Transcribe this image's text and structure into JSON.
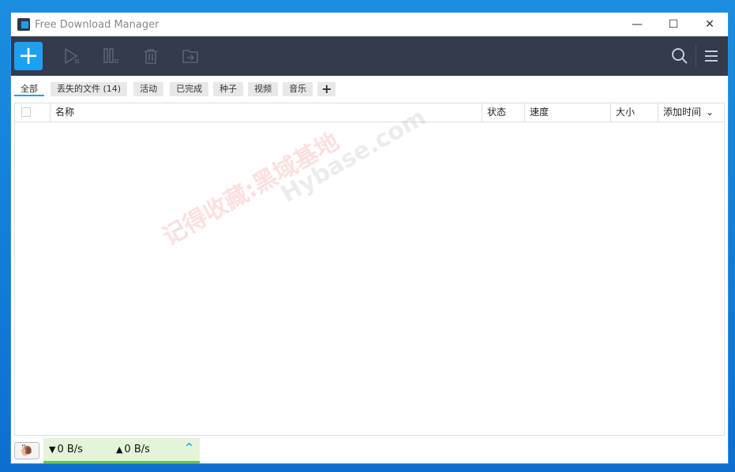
{
  "window": {
    "title": "Free Download Manager",
    "minimize": "—",
    "maximize": "☐",
    "close": "✕"
  },
  "toolbar": {
    "add": "+",
    "icons": [
      "play-icon",
      "pause-icon",
      "trash-icon",
      "move-folder-icon",
      "search-icon",
      "menu-icon"
    ]
  },
  "tabs": [
    {
      "label": "全部",
      "active": true
    },
    {
      "label": "丢失的文件 (14)"
    },
    {
      "label": "活动"
    },
    {
      "label": "已完成"
    },
    {
      "label": "种子"
    },
    {
      "label": "视频"
    },
    {
      "label": "音乐"
    },
    {
      "label": "+"
    }
  ],
  "table": {
    "columns": [
      "名称",
      "状态",
      "速度",
      "大小",
      "添加时间"
    ],
    "sort_indicator": "⌄"
  },
  "status": {
    "download": "0 B/s",
    "upload": "0 B/s",
    "down_arrow": "▼",
    "up_arrow": "▲"
  },
  "watermark": {
    "text1": "记得收藏:黑域基地",
    "text2": "Hybase.com"
  },
  "colors": {
    "accent": "#1ea0f0",
    "toolbar": "#333b4d",
    "speed_bar": "#6cc34a"
  }
}
